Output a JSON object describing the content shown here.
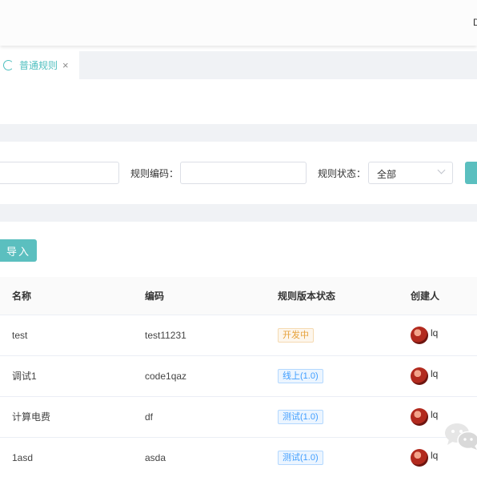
{
  "topbar": {
    "cut_text": "D"
  },
  "tabs": [
    {
      "label": "普通规则",
      "close": "×"
    }
  ],
  "filters": {
    "rule_code_label": "规则编码：",
    "rule_code_value": "",
    "rule_status_label": "规则状态：",
    "rule_status_value": "全部"
  },
  "actions": {
    "import_label": "导入"
  },
  "table": {
    "columns": [
      "名称",
      "编码",
      "规则版本状态",
      "创建人"
    ],
    "rows": [
      {
        "name": "test",
        "code": "test11231",
        "status": "开发中",
        "creator": "lq"
      },
      {
        "name": "调试1",
        "code": "code1qaz",
        "status": "线上(1.0)",
        "creator": "lq"
      },
      {
        "name": "计算电费",
        "code": "df",
        "status": "测试(1.0)",
        "creator": "lq"
      },
      {
        "name": "1asd",
        "code": "asda",
        "status": "测试(1.0)",
        "creator": "lq"
      }
    ]
  },
  "colors": {
    "accent": "#5bbfbf",
    "dev_badge": "#e6a23c",
    "online_badge": "#409eff"
  }
}
